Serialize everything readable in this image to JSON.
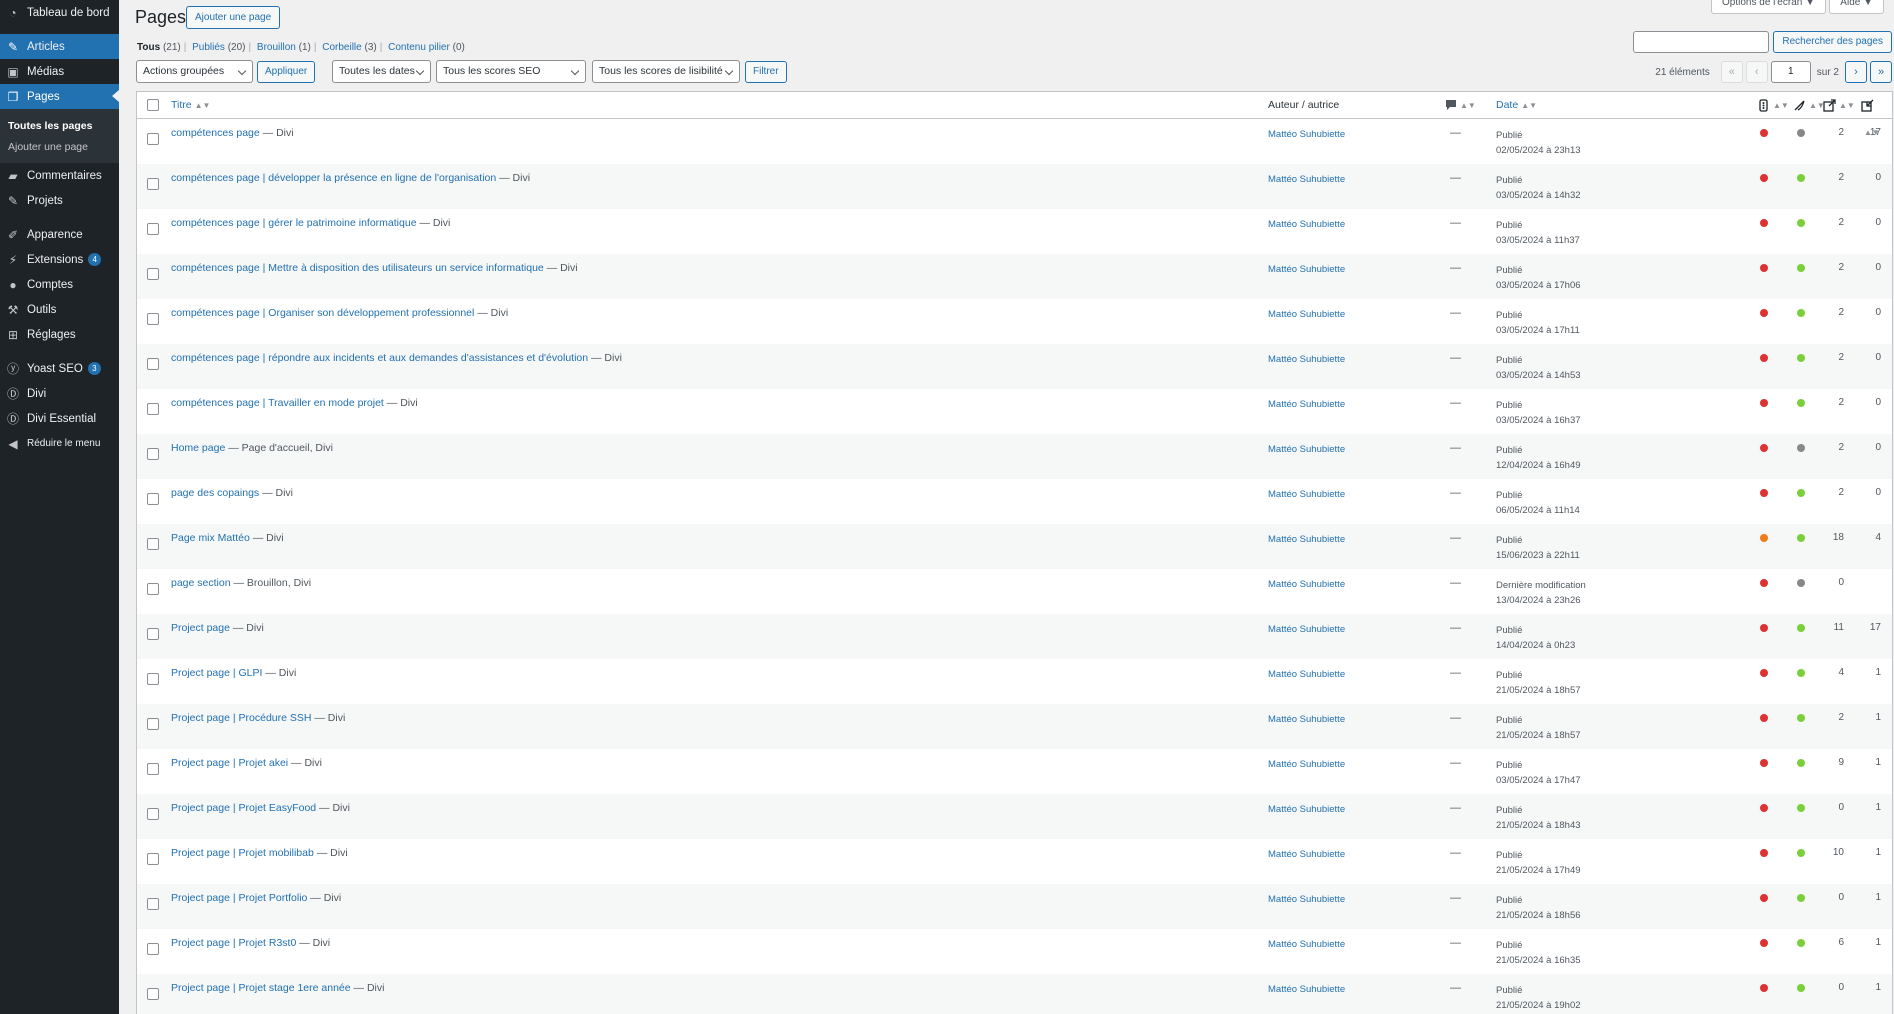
{
  "sidebar": {
    "dashboard": "Tableau de bord",
    "articles": "Articles",
    "medias": "Médias",
    "pages": "Pages",
    "sub_all": "Toutes les pages",
    "sub_add": "Ajouter une page",
    "comments": "Commentaires",
    "projects": "Projets",
    "appearance": "Apparence",
    "extensions": "Extensions",
    "extensions_badge": "4",
    "accounts": "Comptes",
    "tools": "Outils",
    "settings": "Réglages",
    "yoast": "Yoast SEO",
    "yoast_badge": "3",
    "divi": "Divi",
    "divi_essential": "Divi Essential",
    "collapse": "Réduire le menu"
  },
  "header": {
    "title": "Pages",
    "add_button": "Ajouter une page",
    "screen_options": "Options de l'écran ▼",
    "help": "Aide ▼"
  },
  "filters": {
    "all": "Tous",
    "all_count": "(21)",
    "published": "Publiés",
    "published_count": "(20)",
    "draft": "Brouillon",
    "draft_count": "(1)",
    "trash": "Corbeille",
    "trash_count": "(3)",
    "pillar": "Contenu pilier",
    "pillar_count": "(0)"
  },
  "search": {
    "button": "Rechercher des pages",
    "value": ""
  },
  "tablenav": {
    "bulk_actions": "Actions groupées",
    "apply": "Appliquer",
    "dates": "Toutes les dates",
    "seo_scores": "Tous les scores SEO",
    "readability": "Tous les scores de lisibilité",
    "filter": "Filtrer",
    "count": "21 éléments",
    "first": "«",
    "prev": "‹",
    "page": "1",
    "of": "sur 2",
    "next": "›",
    "last": "»"
  },
  "columns": {
    "title": "Titre",
    "author": "Auteur / autrice",
    "date": "Date"
  },
  "colors": {
    "red": "#dc3232",
    "green": "#7ad03a",
    "gray": "#888888",
    "orange": "#ee7c1b",
    "accent": "#2271b1"
  },
  "rows": [
    {
      "title": "compétences page",
      "state": " — Divi",
      "author": "Mattéo Suhubiette",
      "comments": "—",
      "status": "Publié",
      "date": "02/05/2024 à 23h13",
      "seo": "red",
      "read": "gray",
      "links": "2",
      "inc": "17"
    },
    {
      "title": "compétences page | développer la présence en ligne de l'organisation",
      "state": " — Divi",
      "author": "Mattéo Suhubiette",
      "comments": "—",
      "status": "Publié",
      "date": "03/05/2024 à 14h32",
      "seo": "red",
      "read": "green",
      "links": "2",
      "inc": "0"
    },
    {
      "title": "compétences page | gérer le patrimoine informatique",
      "state": " — Divi",
      "author": "Mattéo Suhubiette",
      "comments": "—",
      "status": "Publié",
      "date": "03/05/2024 à 11h37",
      "seo": "red",
      "read": "green",
      "links": "2",
      "inc": "0"
    },
    {
      "title": "compétences page | Mettre à disposition des utilisateurs un service informatique",
      "state": " — Divi",
      "author": "Mattéo Suhubiette",
      "comments": "—",
      "status": "Publié",
      "date": "03/05/2024 à 17h06",
      "seo": "red",
      "read": "green",
      "links": "2",
      "inc": "0"
    },
    {
      "title": "compétences page | Organiser son développement professionnel",
      "state": " — Divi",
      "author": "Mattéo Suhubiette",
      "comments": "—",
      "status": "Publié",
      "date": "03/05/2024 à 17h11",
      "seo": "red",
      "read": "green",
      "links": "2",
      "inc": "0"
    },
    {
      "title": "compétences page | répondre aux incidents et aux demandes d'assistances et d'évolution",
      "state": " — Divi",
      "author": "Mattéo Suhubiette",
      "comments": "—",
      "status": "Publié",
      "date": "03/05/2024 à 14h53",
      "seo": "red",
      "read": "green",
      "links": "2",
      "inc": "0"
    },
    {
      "title": "compétences page | Travailler en mode projet",
      "state": " — Divi",
      "author": "Mattéo Suhubiette",
      "comments": "—",
      "status": "Publié",
      "date": "03/05/2024 à 16h37",
      "seo": "red",
      "read": "green",
      "links": "2",
      "inc": "0"
    },
    {
      "title": "Home page",
      "state": " — Page d'accueil, Divi",
      "author": "Mattéo Suhubiette",
      "comments": "—",
      "status": "Publié",
      "date": "12/04/2024 à 16h49",
      "seo": "red",
      "read": "gray",
      "links": "2",
      "inc": "0"
    },
    {
      "title": "page des copaings",
      "state": " — Divi",
      "author": "Mattéo Suhubiette",
      "comments": "—",
      "status": "Publié",
      "date": "06/05/2024 à 11h14",
      "seo": "red",
      "read": "green",
      "links": "2",
      "inc": "0"
    },
    {
      "title": "Page mix Mattéo",
      "state": " — Divi",
      "author": "Mattéo Suhubiette",
      "comments": "—",
      "status": "Publié",
      "date": "15/06/2023 à 22h11",
      "seo": "orange",
      "read": "green",
      "links": "18",
      "inc": "4"
    },
    {
      "title": "page section",
      "state": " — Brouillon, Divi",
      "author": "Mattéo Suhubiette",
      "comments": "—",
      "status": "Dernière modification",
      "date": "13/04/2024 à 23h26",
      "seo": "red",
      "read": "gray",
      "links": "0",
      "inc": ""
    },
    {
      "title": "Project page",
      "state": " — Divi",
      "author": "Mattéo Suhubiette",
      "comments": "—",
      "status": "Publié",
      "date": "14/04/2024 à 0h23",
      "seo": "red",
      "read": "green",
      "links": "11",
      "inc": "17"
    },
    {
      "title": "Project page | GLPI",
      "state": " — Divi",
      "author": "Mattéo Suhubiette",
      "comments": "—",
      "status": "Publié",
      "date": "21/05/2024 à 18h57",
      "seo": "red",
      "read": "green",
      "links": "4",
      "inc": "1"
    },
    {
      "title": "Project page | Procédure SSH",
      "state": " — Divi",
      "author": "Mattéo Suhubiette",
      "comments": "—",
      "status": "Publié",
      "date": "21/05/2024 à 18h57",
      "seo": "red",
      "read": "green",
      "links": "2",
      "inc": "1"
    },
    {
      "title": "Project page | Projet akei",
      "state": " — Divi",
      "author": "Mattéo Suhubiette",
      "comments": "—",
      "status": "Publié",
      "date": "03/05/2024 à 17h47",
      "seo": "red",
      "read": "green",
      "links": "9",
      "inc": "1"
    },
    {
      "title": "Project page | Projet EasyFood",
      "state": " — Divi",
      "author": "Mattéo Suhubiette",
      "comments": "—",
      "status": "Publié",
      "date": "21/05/2024 à 18h43",
      "seo": "red",
      "read": "green",
      "links": "0",
      "inc": "1"
    },
    {
      "title": "Project page | Projet mobilibab",
      "state": " — Divi",
      "author": "Mattéo Suhubiette",
      "comments": "—",
      "status": "Publié",
      "date": "21/05/2024 à 17h49",
      "seo": "red",
      "read": "green",
      "links": "10",
      "inc": "1"
    },
    {
      "title": "Project page | Projet Portfolio",
      "state": " — Divi",
      "author": "Mattéo Suhubiette",
      "comments": "—",
      "status": "Publié",
      "date": "21/05/2024 à 18h56",
      "seo": "red",
      "read": "green",
      "links": "0",
      "inc": "1"
    },
    {
      "title": "Project page | Projet R3st0",
      "state": " — Divi",
      "author": "Mattéo Suhubiette",
      "comments": "—",
      "status": "Publié",
      "date": "21/05/2024 à 16h35",
      "seo": "red",
      "read": "green",
      "links": "6",
      "inc": "1"
    },
    {
      "title": "Project page | Projet stage 1ere année",
      "state": " — Divi",
      "author": "Mattéo Suhubiette",
      "comments": "—",
      "status": "Publié",
      "date": "21/05/2024 à 19h02",
      "seo": "red",
      "read": "green",
      "links": "0",
      "inc": "1"
    }
  ]
}
